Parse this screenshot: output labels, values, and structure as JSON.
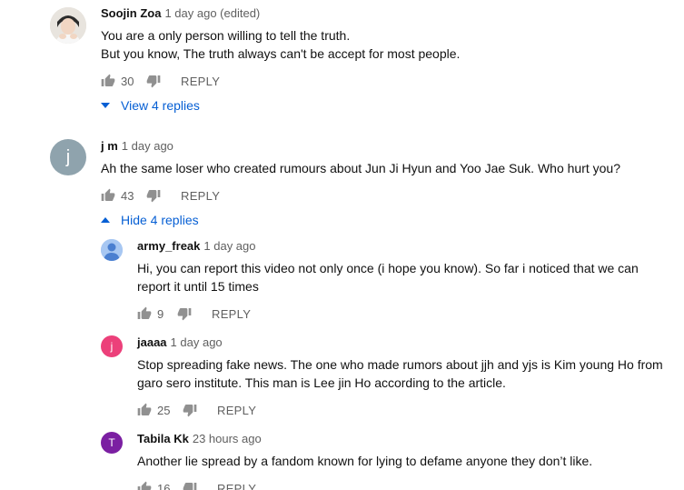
{
  "comments": [
    {
      "author": "Soojin Zoa",
      "time": "1 day ago (edited)",
      "text": "You are a only person willing to tell the truth.\nBut you know, The truth always can't be accept for most people.",
      "likes": "30",
      "reply_label": "REPLY",
      "toggle_label": "View 4 replies"
    },
    {
      "author": "j m",
      "avatar_letter": "j",
      "avatar_color": "#8fa3ad",
      "time": "1 day ago",
      "text": "Ah the same loser who created rumours about Jun Ji Hyun and Yoo Jae Suk. Who hurt you?",
      "likes": "43",
      "reply_label": "REPLY",
      "toggle_label": "Hide 4 replies"
    }
  ],
  "replies": [
    {
      "author": "army_freak",
      "time": "1 day ago",
      "avatar_color": "#4a90e2",
      "text": "Hi, you can report this video not only once (i hope you know). So far i noticed that we can\nreport it until 15 times",
      "likes": "9",
      "reply_label": "REPLY"
    },
    {
      "author": "jaaaa",
      "avatar_letter": "j",
      "avatar_color": "#ec407a",
      "time": "1 day ago",
      "text": "Stop spreading fake news. The one who made rumors about jjh and yjs is Kim young Ho from\ngaro sero institute. This man is Lee jin Ho according to the article.",
      "likes": "25",
      "reply_label": "REPLY"
    },
    {
      "author": "Tabila Kk",
      "avatar_letter": "T",
      "avatar_color": "#7b1fa2",
      "time": "23 hours ago",
      "text": "Another lie spread by a fandom known for lying to defame anyone they don’t like.",
      "likes": "16",
      "reply_label": "REPLY"
    }
  ]
}
